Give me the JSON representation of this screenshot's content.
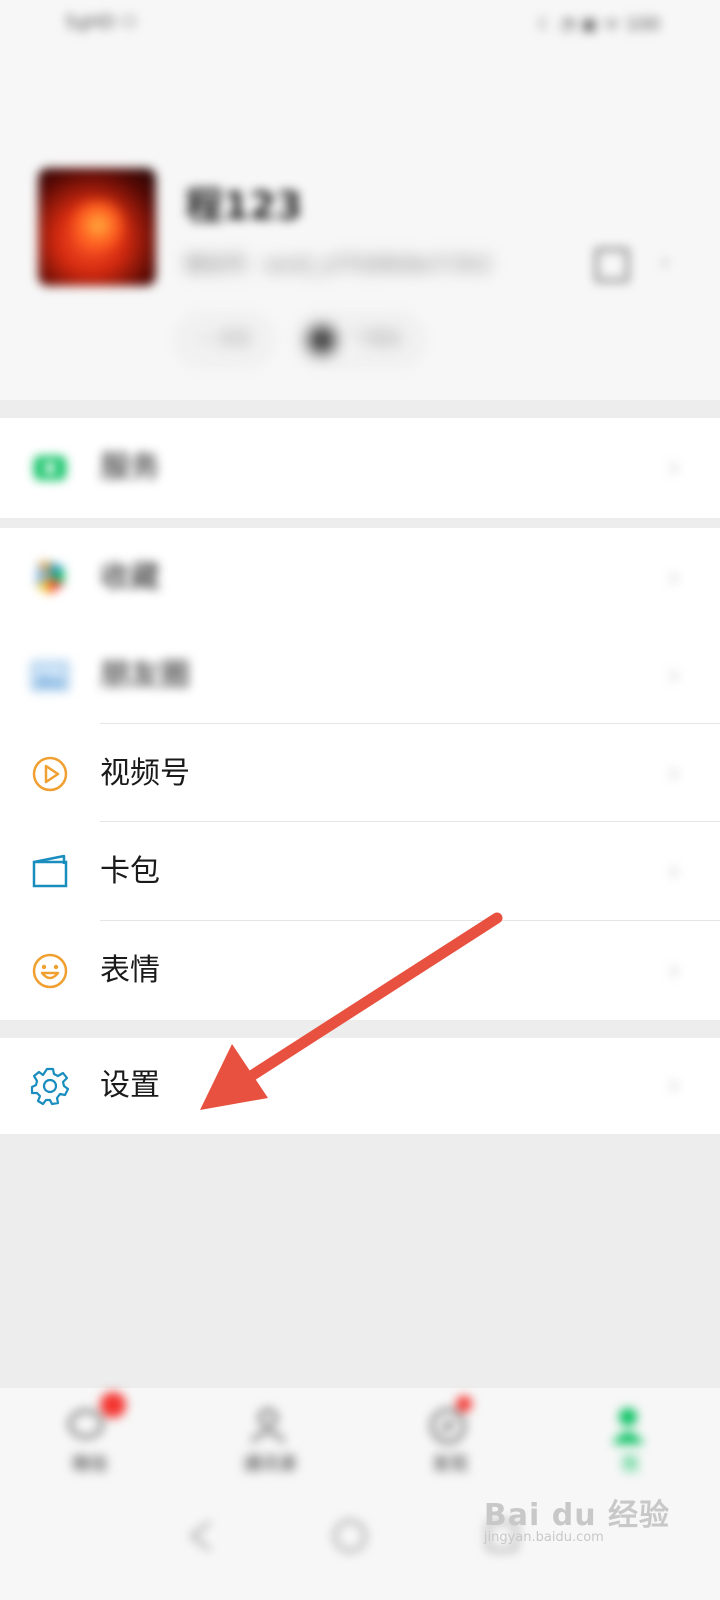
{
  "status_bar": {
    "left": "5gHD ⚇",
    "right": "☾ ◔ ▣ ᯤ 100"
  },
  "profile": {
    "nickname": "程123",
    "wechat_id_label": "微信号：wxid_a7f3d9k8w7r3h2",
    "status_label": "+ 状态",
    "friends_label": "个朋友"
  },
  "menu": {
    "services": {
      "label": "服务"
    },
    "favorites": {
      "label": "收藏"
    },
    "moments": {
      "label": "朋友圈"
    },
    "channels": {
      "label": "视频号"
    },
    "cards": {
      "label": "卡包"
    },
    "stickers": {
      "label": "表情"
    },
    "settings": {
      "label": "设置"
    },
    "chevron": "›"
  },
  "tabbar": {
    "chats": "微信",
    "contacts": "通讯录",
    "discover": "发现",
    "me": "我"
  },
  "watermark": {
    "brand": "Bai du 经验",
    "url": "jingyan.baidu.com"
  },
  "colors": {
    "green": "#07c160",
    "orange": "#f0a030",
    "teal": "#1a8dbf",
    "badge_red": "#f43530",
    "arrow_red": "#e8513f"
  }
}
